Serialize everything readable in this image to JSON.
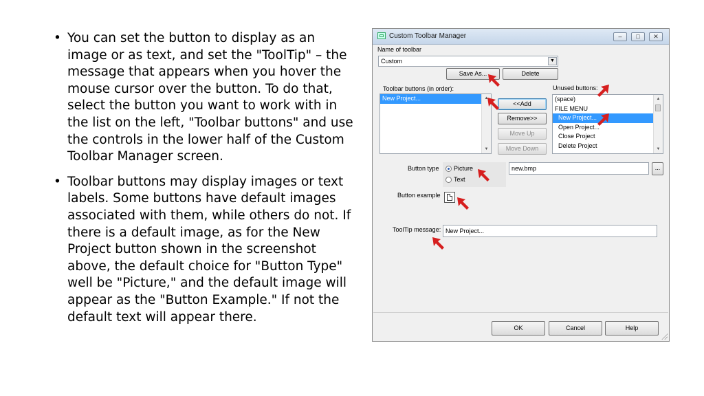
{
  "bullets": [
    "You can set the button to display as an image or as text, and set the \"ToolTip\" – the message that appears when you hover the mouse cursor over the button. To do that, select the button you want to work with in the list on the left, \"Toolbar buttons\" and use the controls in the lower half of the Custom Toolbar Manager screen.",
    "Toolbar buttons may display images or text labels. Some buttons have default images associated with them, while others do not. If there is a default image, as for the New Project button shown in the screenshot above, the default choice for \"Button Type\" well be \"Picture,\" and the default image will appear as the \"Button Example.\" If not the default text will appear there."
  ],
  "dialog": {
    "title": "Custom Toolbar Manager",
    "toolbar_name_label": "Name of toolbar",
    "toolbar_name_value": "Custom",
    "save_as": "Save As...",
    "delete": "Delete",
    "toolbar_buttons_label": "Toolbar buttons (in order):",
    "toolbar_buttons": [
      "New Project..."
    ],
    "unused_buttons_label": "Unused buttons:",
    "unused_buttons": [
      "(space)",
      "FILE MENU",
      "New Project...",
      "Open Project...",
      "Close Project",
      "Delete Project"
    ],
    "add": "<<Add",
    "remove": "Remove>>",
    "move_up": "Move Up",
    "move_down": "Move Down",
    "button_type_label": "Button type",
    "picture": "Picture",
    "text": "Text",
    "image_file": "new.bmp",
    "browse": "...",
    "button_example_label": "Button example",
    "tooltip_label": "ToolTip message:",
    "tooltip_value": "New Project...",
    "ok": "OK",
    "cancel": "Cancel",
    "help": "Help"
  },
  "colors": {
    "selection": "#3399ff",
    "annotation_arrow": "#d61f1f"
  },
  "icons": [
    "app-icon",
    "minimize-icon",
    "maximize-icon",
    "close-icon",
    "red-pointer-arrow-icon",
    "document-icon"
  ]
}
